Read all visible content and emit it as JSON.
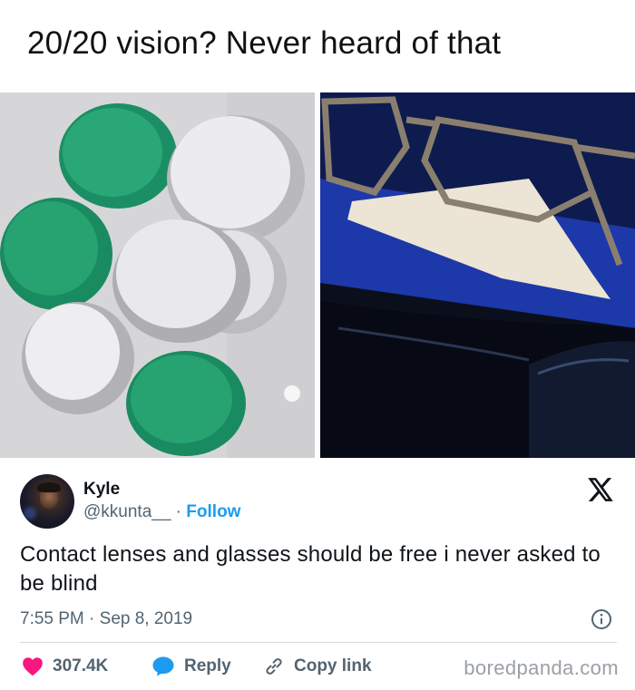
{
  "headline": "20/20 vision? Never heard of that",
  "images": {
    "left": "contact-lens-cases-photo",
    "right": "eyeglasses-on-cloth-photo"
  },
  "tweet": {
    "author_name": "Kyle",
    "author_handle": "@kkunta__",
    "separator": " · ",
    "follow_label": "Follow",
    "text": "Contact lenses and glasses should be free i never asked to be blind",
    "timestamp": "7:55 PM · Sep 8, 2019",
    "likes": "307.4K",
    "reply_label": "Reply",
    "copy_link_label": "Copy link"
  },
  "watermark": "boredpanda.com",
  "colors": {
    "accent_blue": "#1d9bf0",
    "like_red": "#f91880",
    "text_dark": "#0f1419",
    "text_muted": "#536471",
    "lens_case_green": "#1f9a6e"
  },
  "icons": [
    "x-logo-icon",
    "info-icon",
    "heart-icon",
    "reply-bubble-icon",
    "link-icon"
  ]
}
